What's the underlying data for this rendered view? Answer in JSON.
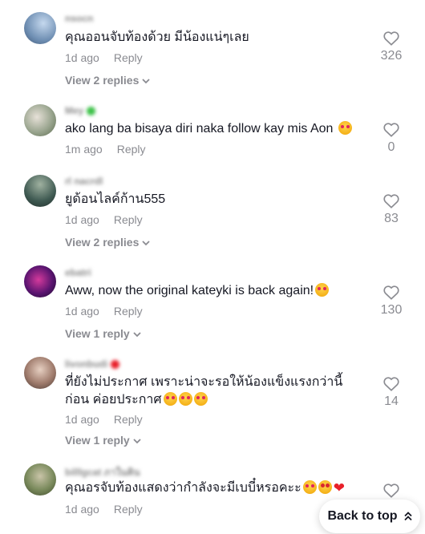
{
  "comments": [
    {
      "username": "nsocn",
      "text": "คุณออนจับท้องด้วย มีน้องแน่ๆเลย",
      "emoji": "",
      "time": "1d ago",
      "reply": "Reply",
      "likes": "326",
      "view_replies": "View 2 replies"
    },
    {
      "username": "Mey",
      "text": "ako lang ba bisaya diri naka follow kay mis Aon",
      "emoji": "smiling-hearts",
      "time": "1m ago",
      "reply": "Reply",
      "likes": "0",
      "view_replies": ""
    },
    {
      "username": "rl nacrdl",
      "text": "ยูด้อนไลค์ก้าน555",
      "emoji": "",
      "time": "1d ago",
      "reply": "Reply",
      "likes": "83",
      "view_replies": "View 2 replies"
    },
    {
      "username": "ebatri",
      "text": "Aww, now the original kateyki is back again!",
      "emoji": "smiling-hearts",
      "time": "1d ago",
      "reply": "Reply",
      "likes": "130",
      "view_replies": "View 1 reply"
    },
    {
      "username": "livonbudi",
      "text": "ที่ยังไม่ประกาศ เพราะน่าจะรอให้น้องแข็งแรงกว่านี้ก่อน ค่อยประกาศ",
      "emoji": "smiling-hearts x3",
      "time": "1d ago",
      "reply": "Reply",
      "likes": "14",
      "view_replies": "View 1 reply"
    },
    {
      "username": "billlgcat ภาในคิน",
      "text": "คุณอรจับท้องแสดงว่ากำลังจะมีเบบี๋หรอคะะ",
      "emoji": "smiling-hearts, star-struck, red-heart",
      "time": "1d ago",
      "reply": "Reply",
      "likes": "",
      "view_replies": ""
    }
  ],
  "back_to_top": {
    "label": "Back to top"
  },
  "colors": {
    "text": "#161823",
    "muted": "#8a8b91",
    "accent_green": "#3ec24a",
    "accent_red": "#e8202a"
  }
}
